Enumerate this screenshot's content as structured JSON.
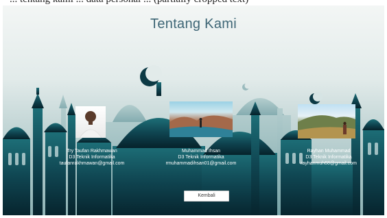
{
  "caption": "... tentang kami ... data personal ... (partially cropped text)",
  "page": {
    "title": "Tentang Kami"
  },
  "members": [
    {
      "name": "Try Taufan Rakhmawan",
      "program": "D3 Teknik Informatika",
      "email": "taufanrakhmawan@gmail.com"
    },
    {
      "name": "Muhammad Ihsan",
      "program": "D3 Teknik Informatika",
      "email": "rmuhammadihsan01@gmail.com"
    },
    {
      "name": "Rayhan Muhammad",
      "program": "D3 Teknik Informatika",
      "email": "rayhanmuh68@gmail.com"
    }
  ],
  "buttons": {
    "back_label": "Kembali"
  },
  "colors": {
    "title": "#3d6575",
    "silhouette": "#0d3a45",
    "accent_teal": "#1f6b74"
  }
}
